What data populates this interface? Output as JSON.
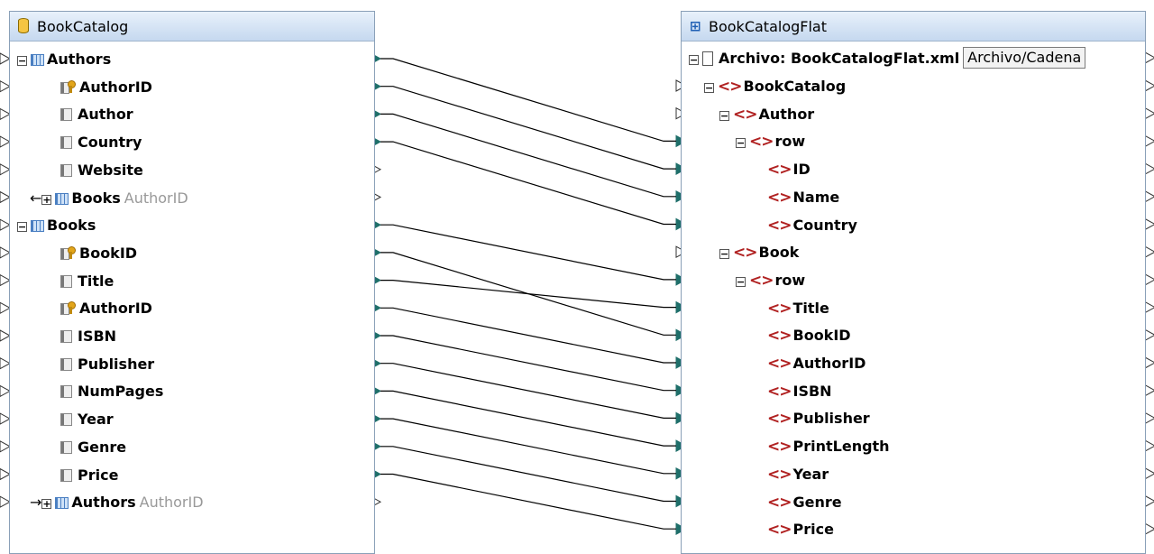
{
  "left_component": {
    "title": "BookCatalog",
    "rows": [
      {
        "label": "Authors",
        "kind": "table",
        "expander": "minus"
      },
      {
        "label": "AuthorID",
        "kind": "key"
      },
      {
        "label": "Author",
        "kind": "column"
      },
      {
        "label": "Country",
        "kind": "column"
      },
      {
        "label": "Website",
        "kind": "column"
      },
      {
        "label": "Books",
        "kind": "related-table",
        "expander": "plus",
        "arrow": "←",
        "sub": "AuthorID"
      },
      {
        "label": "Books",
        "kind": "table",
        "expander": "minus"
      },
      {
        "label": "BookID",
        "kind": "key"
      },
      {
        "label": "Title",
        "kind": "column"
      },
      {
        "label": "AuthorID",
        "kind": "key"
      },
      {
        "label": "ISBN",
        "kind": "column"
      },
      {
        "label": "Publisher",
        "kind": "column"
      },
      {
        "label": "NumPages",
        "kind": "column"
      },
      {
        "label": "Year",
        "kind": "column"
      },
      {
        "label": "Genre",
        "kind": "column"
      },
      {
        "label": "Price",
        "kind": "column"
      },
      {
        "label": "Authors",
        "kind": "related-table",
        "expander": "plus",
        "arrow": "→",
        "sub": "AuthorID"
      }
    ]
  },
  "right_component": {
    "title": "BookCatalogFlat",
    "file_label": "Archivo: BookCatalogFlat.xml",
    "file_button": "Archivo/Cadena",
    "rows": [
      {
        "label": "BookCatalog",
        "level": 1,
        "expander": "minus"
      },
      {
        "label": "Author",
        "level": 2,
        "expander": "minus"
      },
      {
        "label": "row",
        "level": 3,
        "expander": "minus"
      },
      {
        "label": "ID",
        "level": 4
      },
      {
        "label": "Name",
        "level": 4
      },
      {
        "label": "Country",
        "level": 4
      },
      {
        "label": "Book",
        "level": 2,
        "expander": "minus"
      },
      {
        "label": "row",
        "level": 3,
        "expander": "minus"
      },
      {
        "label": "Title",
        "level": 4
      },
      {
        "label": "BookID",
        "level": 4
      },
      {
        "label": "AuthorID",
        "level": 4
      },
      {
        "label": "ISBN",
        "level": 4
      },
      {
        "label": "Publisher",
        "level": 4
      },
      {
        "label": "PrintLength",
        "level": 4
      },
      {
        "label": "Year",
        "level": 4
      },
      {
        "label": "Genre",
        "level": 4
      },
      {
        "label": "Price",
        "level": 4
      }
    ]
  },
  "connections": [
    {
      "from": "Authors",
      "to": "row"
    },
    {
      "from": "AuthorID",
      "to": "ID"
    },
    {
      "from": "Author",
      "to": "Name"
    },
    {
      "from": "Country",
      "to": "Country"
    },
    {
      "from": "Books",
      "to": "row"
    },
    {
      "from": "BookID",
      "to": "BookID"
    },
    {
      "from": "Title",
      "to": "Title"
    },
    {
      "from": "AuthorID",
      "to": "AuthorID"
    },
    {
      "from": "ISBN",
      "to": "ISBN"
    },
    {
      "from": "Publisher",
      "to": "Publisher"
    },
    {
      "from": "NumPages",
      "to": "PrintLength"
    },
    {
      "from": "Year",
      "to": "Year"
    },
    {
      "from": "Genre",
      "to": "Genre"
    },
    {
      "from": "Price",
      "to": "Price"
    }
  ],
  "colors": {
    "connector": "#1f6f6a",
    "wire": "#000000",
    "element": "#b02020",
    "table": "#4a7fc2"
  }
}
